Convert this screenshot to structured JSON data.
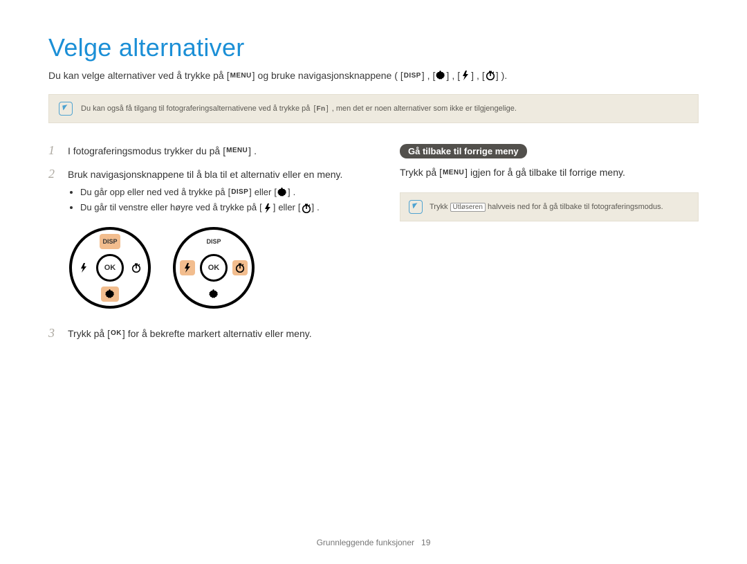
{
  "title": "Velge alternativer",
  "intro": {
    "part1": "Du kan velge alternativer ved å trykke på ",
    "menu": "MENU",
    "part2": " og bruke navigasjonsknappene (",
    "disp": "DISP",
    "part3": ", ",
    "part4": ", ",
    "part5": ", ",
    "part6": ")."
  },
  "topNote": {
    "before": "Du kan også få tilgang til fotograferingsalternativene ved å trykke på ",
    "fn": "Fn",
    "after": ", men det er noen alternativer som ikke er tilgjengelige."
  },
  "steps": {
    "s1": {
      "num": "1",
      "before": "I fotograferingsmodus trykker du på ",
      "menu": "MENU",
      "after": "."
    },
    "s2": {
      "num": "2",
      "text": "Bruk navigasjonsknappene til å bla til et alternativ eller en meny.",
      "bullet1": {
        "a": "Du går opp eller ned ved å trykke på ",
        "disp": "DISP",
        "mid": " eller ",
        "end": "."
      },
      "bullet2": {
        "a": "Du går til venstre eller høyre ved å trykke på ",
        "mid": " eller ",
        "end": "."
      }
    },
    "s3": {
      "num": "3",
      "before": "Trykk på ",
      "ok": "OK",
      "after": " for å bekrefte markert alternativ eller meny."
    }
  },
  "dials": {
    "disp": "DISP",
    "ok": "OK"
  },
  "right": {
    "heading": "Gå tilbake til forrige meny",
    "before": "Trykk på ",
    "menu": "MENU",
    "after": " igjen for å gå tilbake til forrige meny.",
    "note_before": "Trykk ",
    "note_kbd": "Utløseren",
    "note_after": " halvveis ned for å gå tilbake til fotograferingsmodus."
  },
  "footer": {
    "section": "Grunnleggende funksjoner",
    "page": "19"
  }
}
